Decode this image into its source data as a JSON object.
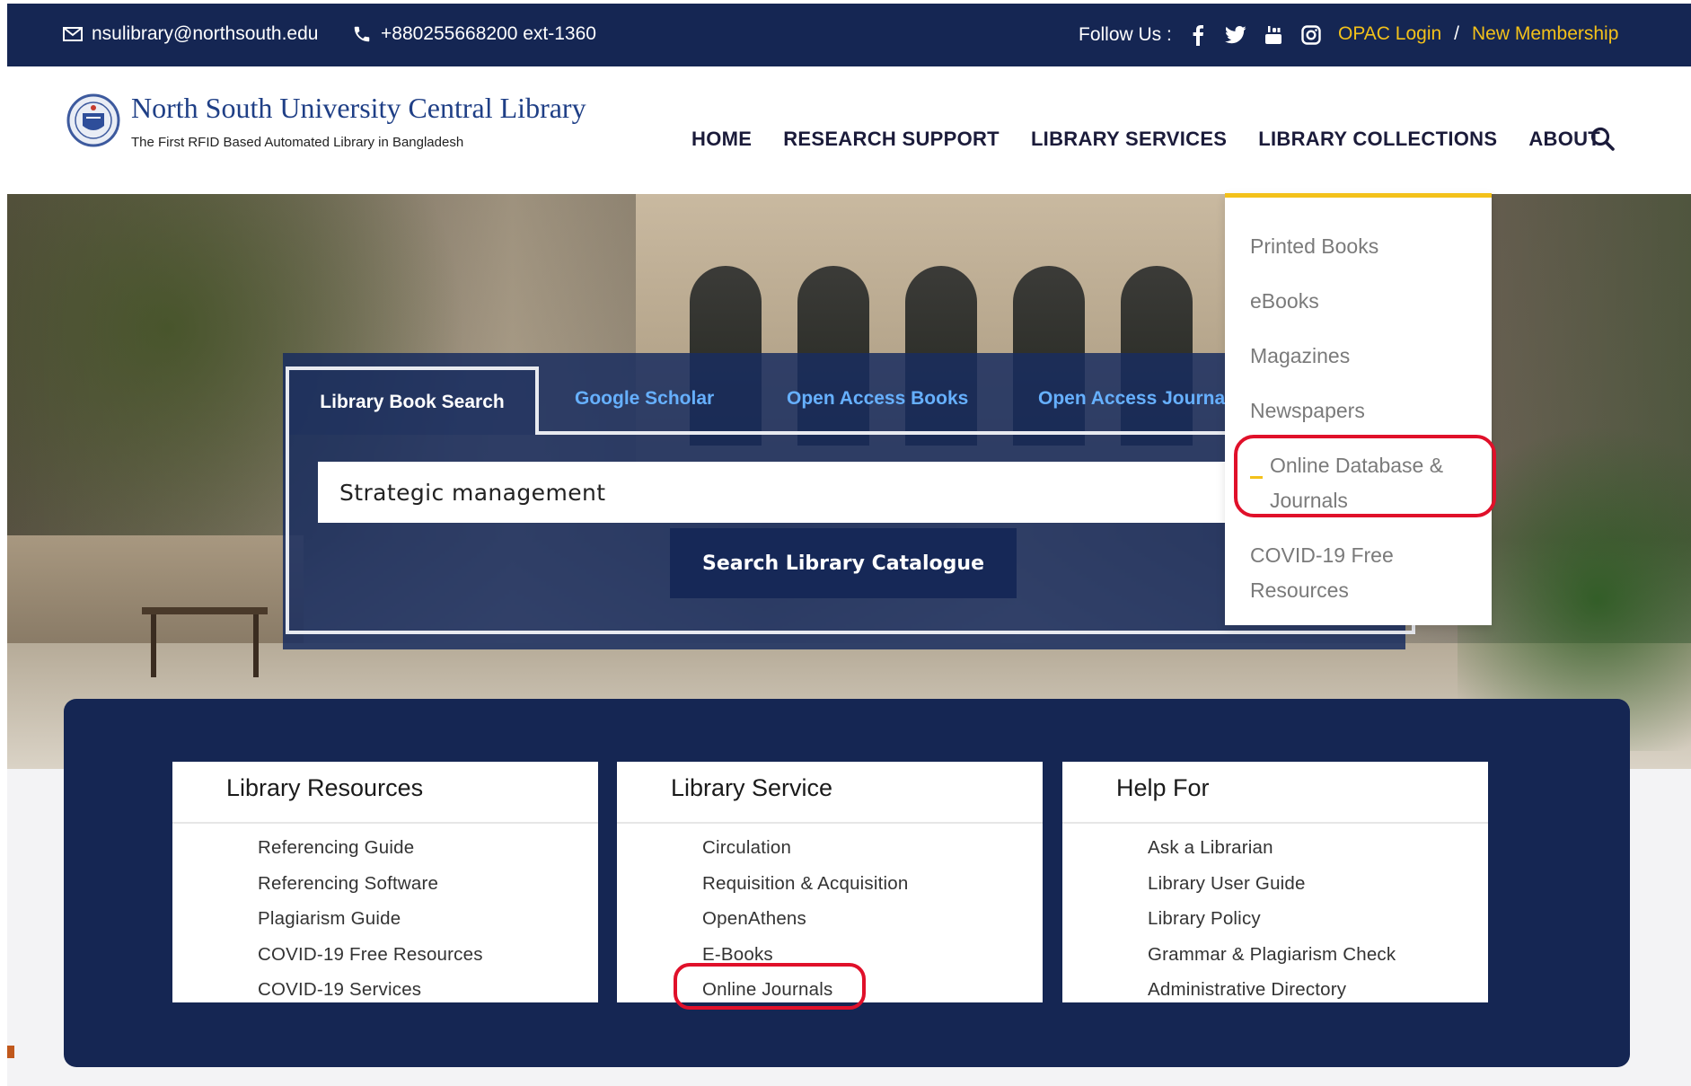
{
  "topbar": {
    "email": "nsulibrary@northsouth.edu",
    "phone": "+880255668200 ext-1360",
    "follow_label": "Follow Us :",
    "social": [
      "facebook-icon",
      "twitter-icon",
      "youtube-icon",
      "instagram-icon"
    ],
    "opac_login": "OPAC Login",
    "separator": "/",
    "new_membership": "New Membership"
  },
  "header": {
    "title": "North South University Central Library",
    "subtitle": "The First RFID Based Automated Library in Bangladesh",
    "nav": [
      "HOME",
      "RESEARCH SUPPORT",
      "LIBRARY SERVICES",
      "LIBRARY COLLECTIONS",
      "ABOUT"
    ]
  },
  "search": {
    "tabs": [
      "Library Book Search",
      "Google Scholar",
      "Open Access Books",
      "Open Access Journals"
    ],
    "query": "Strategic management",
    "button": "Search Library Catalogue"
  },
  "dropdown": {
    "items": [
      "Printed Books",
      "eBooks",
      "Magazines",
      "Newspapers",
      "Online Database &",
      "Journals",
      "COVID-19 Free",
      "Resources"
    ]
  },
  "cards": [
    {
      "title": "Library Resources",
      "items": [
        "Referencing Guide",
        "Referencing Software",
        "Plagiarism Guide",
        "COVID-19 Free Resources",
        "COVID-19 Services"
      ]
    },
    {
      "title": "Library Service",
      "items": [
        "Circulation",
        "Requisition & Acquisition",
        "OpenAthens",
        "E-Books",
        "Online Journals"
      ]
    },
    {
      "title": "Help For",
      "items": [
        "Ask a Librarian",
        "Library User Guide",
        "Library Policy",
        "Grammar & Plagiarism Check",
        "Administrative Directory"
      ]
    }
  ],
  "colors": {
    "navy": "#152653",
    "gold": "#f3c11a",
    "annotation_red": "#e0102a",
    "tab_link": "#66b0ff"
  }
}
